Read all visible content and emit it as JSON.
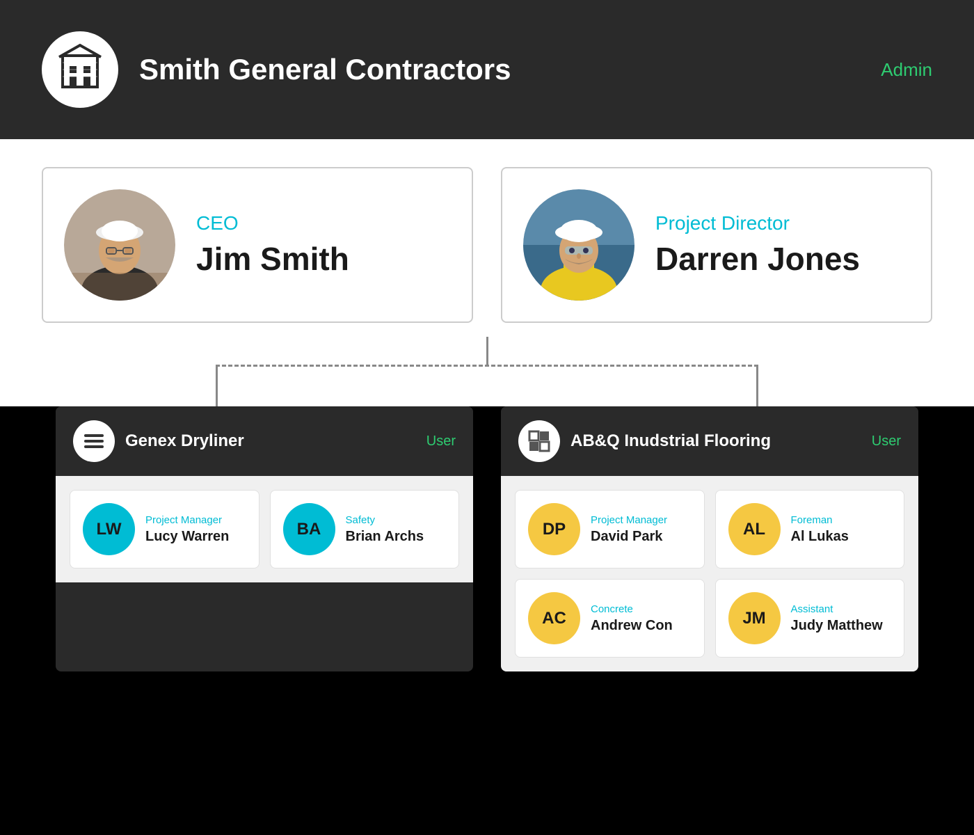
{
  "header": {
    "company_name": "Smith General Contractors",
    "admin_label": "Admin"
  },
  "top_section": {
    "ceo": {
      "role": "CEO",
      "name": "Jim Smith"
    },
    "project_director": {
      "role": "Project Director",
      "name": "Darren Jones"
    }
  },
  "sub_companies": [
    {
      "name": "Genex Dryliner",
      "user_label": "User",
      "members": [
        {
          "initials": "LW",
          "role": "Project Manager",
          "name": "Lucy Warren",
          "color": "teal"
        },
        {
          "initials": "BA",
          "role": "Safety",
          "name": "Brian Archs",
          "color": "teal"
        }
      ]
    },
    {
      "name": "AB&Q Inudstrial Flooring",
      "user_label": "User",
      "members": [
        {
          "initials": "DP",
          "role": "Project Manager",
          "name": "David Park",
          "color": "yellow"
        },
        {
          "initials": "AL",
          "role": "Foreman",
          "name": "Al Lukas",
          "color": "yellow"
        },
        {
          "initials": "AC",
          "role": "Concrete",
          "name": "Andrew Con",
          "color": "yellow"
        },
        {
          "initials": "JM",
          "role": "Assistant",
          "name": "Judy Matthew",
          "color": "yellow"
        }
      ]
    }
  ]
}
